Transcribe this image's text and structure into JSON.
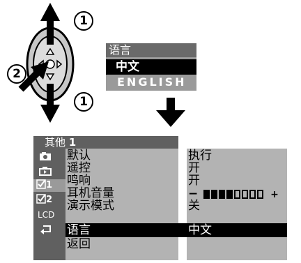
{
  "callouts": {
    "one_top": "1",
    "one_bottom": "1",
    "two": "2"
  },
  "language_popup": {
    "title": "语言",
    "options": [
      "中文",
      "ENGLISH"
    ],
    "selected_index": 0
  },
  "menu": {
    "header_prefix": "其他",
    "header_number": "1",
    "tabs": [
      {
        "icon": "camera-icon"
      },
      {
        "icon": "playback-icon"
      },
      {
        "icon": "checkbox-1-icon",
        "label": "1"
      },
      {
        "icon": "checkbox-2-icon",
        "label": "2"
      },
      {
        "icon": "lcd-icon",
        "label": "LCD"
      },
      {
        "icon": "return-icon"
      }
    ],
    "items": [
      "默认",
      "遥控",
      "鸣响",
      "耳机音量",
      "演示模式",
      "语言",
      "返回"
    ],
    "selected_index": 5,
    "values": [
      "执行",
      "开",
      "开",
      "−",
      "+",
      "关",
      "中文"
    ],
    "volume_level_fraction": 0.5
  }
}
